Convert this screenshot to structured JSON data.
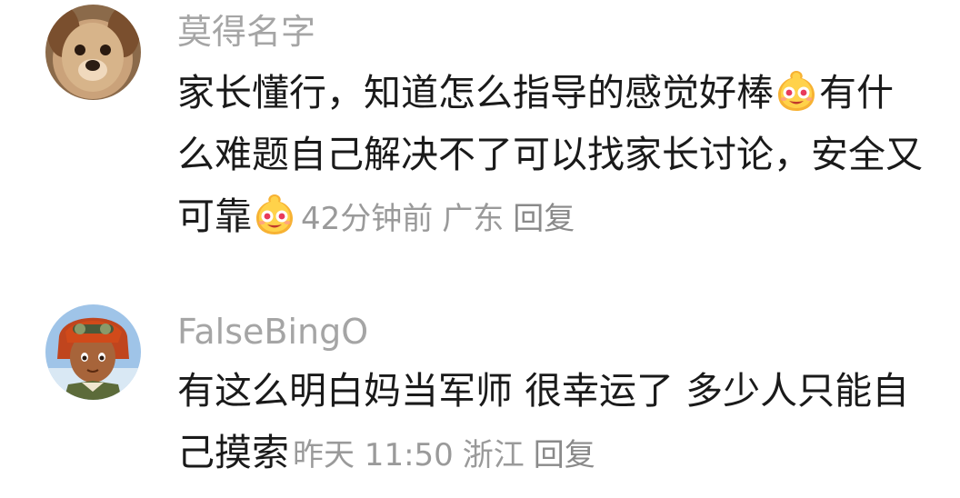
{
  "comments": [
    {
      "username": "莫得名字",
      "avatar_icon": "dog-avatar",
      "text_parts": [
        "家长懂行，知道怎么指导的感觉好棒",
        "有什么难题自己解决不了可以找家长讨论，安全又可靠"
      ],
      "emoji_icon": "star-eyes-emoji",
      "time": "42分钟前",
      "location": "广东",
      "reply_label": "回复"
    },
    {
      "username": "FalseBingO",
      "avatar_icon": "anime-character-avatar",
      "text": "有这么明白妈当军师 很幸运了 多少人只能自己摸索",
      "time": "昨天 11:50",
      "location": "浙江",
      "reply_label": "回复"
    }
  ],
  "colors": {
    "username": "#a5a5a5",
    "text": "#1a1a1a",
    "meta": "#9a9a9a"
  }
}
